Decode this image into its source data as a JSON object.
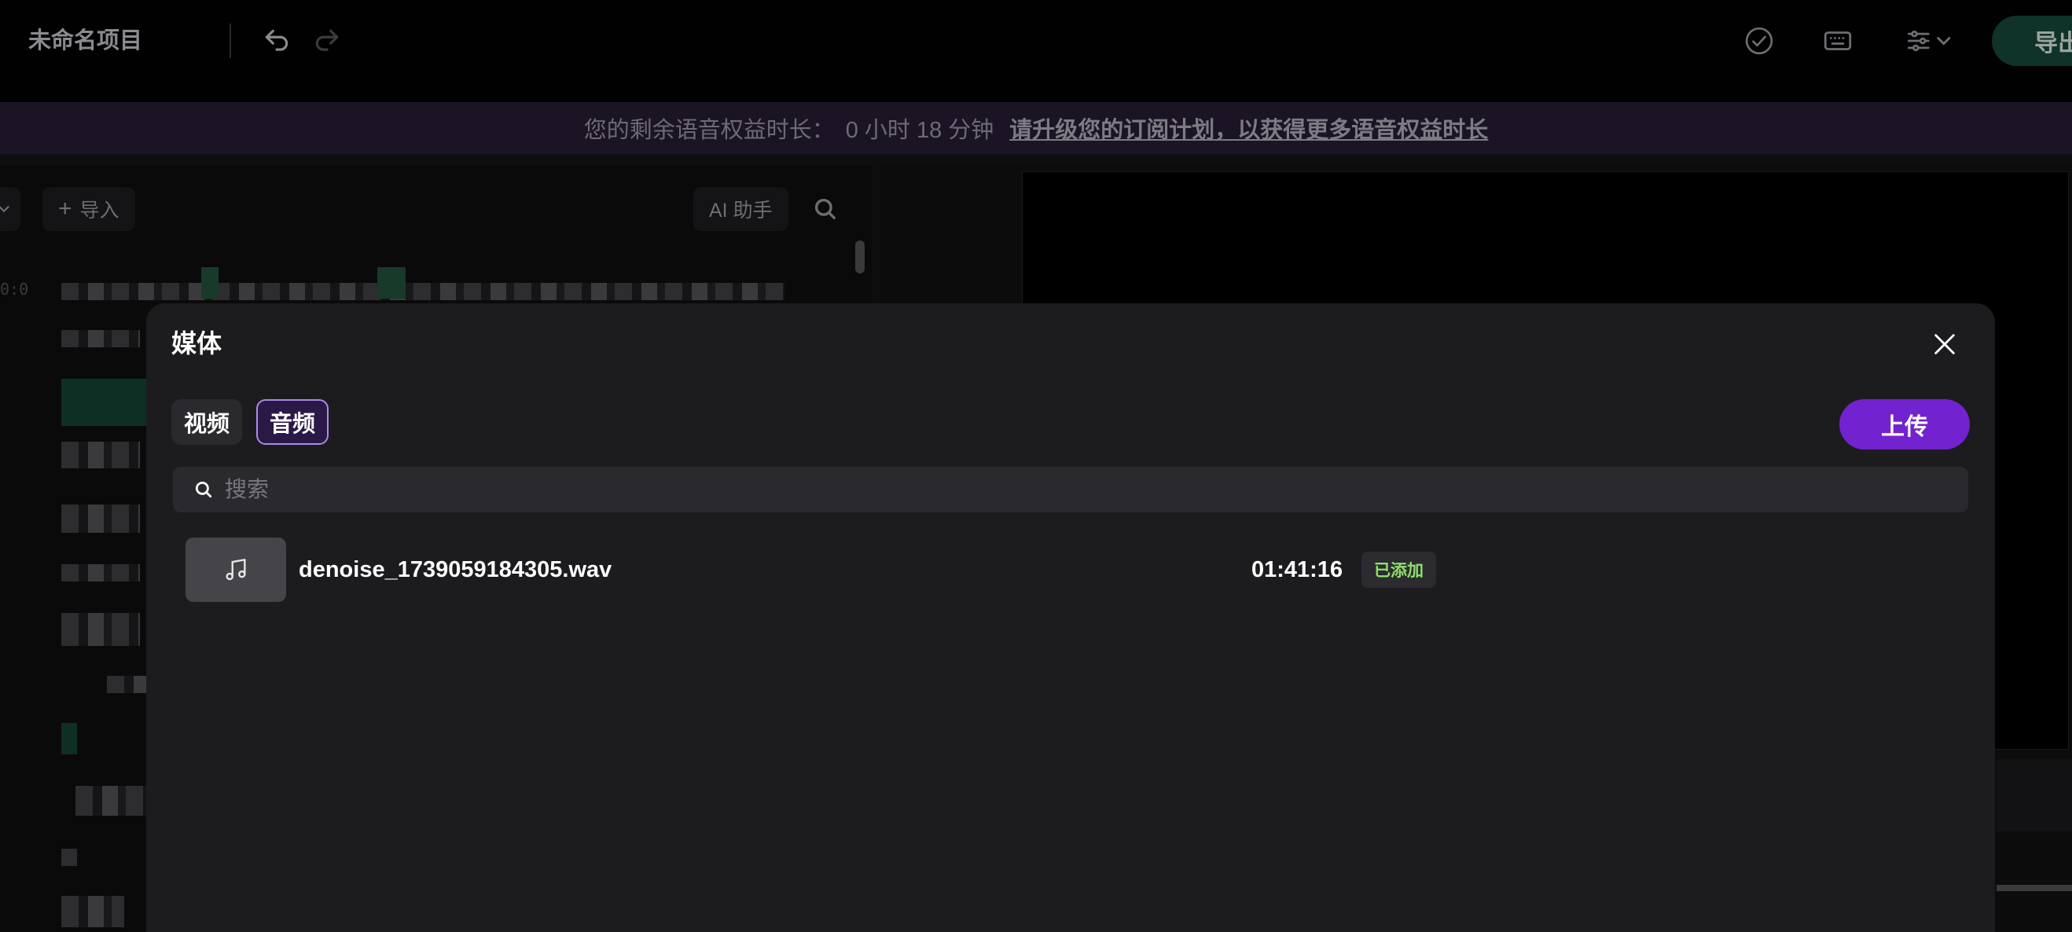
{
  "header": {
    "project_title": "未命名项目",
    "export_label": "导出",
    "icons": [
      "undo-icon",
      "redo-icon",
      "check-circle-icon",
      "keyboard-icon",
      "settings-sliders-icon"
    ]
  },
  "banner": {
    "prefix": "您的剩余语音权益时长：",
    "value": "0 小时 18 分钟",
    "link": "请升级您的订阅计划，以获得更多语音权益时长"
  },
  "editor": {
    "import_label": "导入",
    "ai_assistant_label": "AI 助手",
    "timecode": "0:0"
  },
  "modal": {
    "title": "媒体",
    "tabs": [
      {
        "label": "视频",
        "active": false
      },
      {
        "label": "音频",
        "active": true
      }
    ],
    "upload_label": "上传",
    "search_placeholder": "搜索",
    "items": [
      {
        "name": "denoise_1739059184305.wav",
        "duration": "01:41:16",
        "status": "已添加",
        "icon": "music-note-icon"
      }
    ]
  },
  "colors": {
    "accent_purple": "#7322cf",
    "added_green": "#8fe06a",
    "modal_bg": "#1c1c1f"
  }
}
